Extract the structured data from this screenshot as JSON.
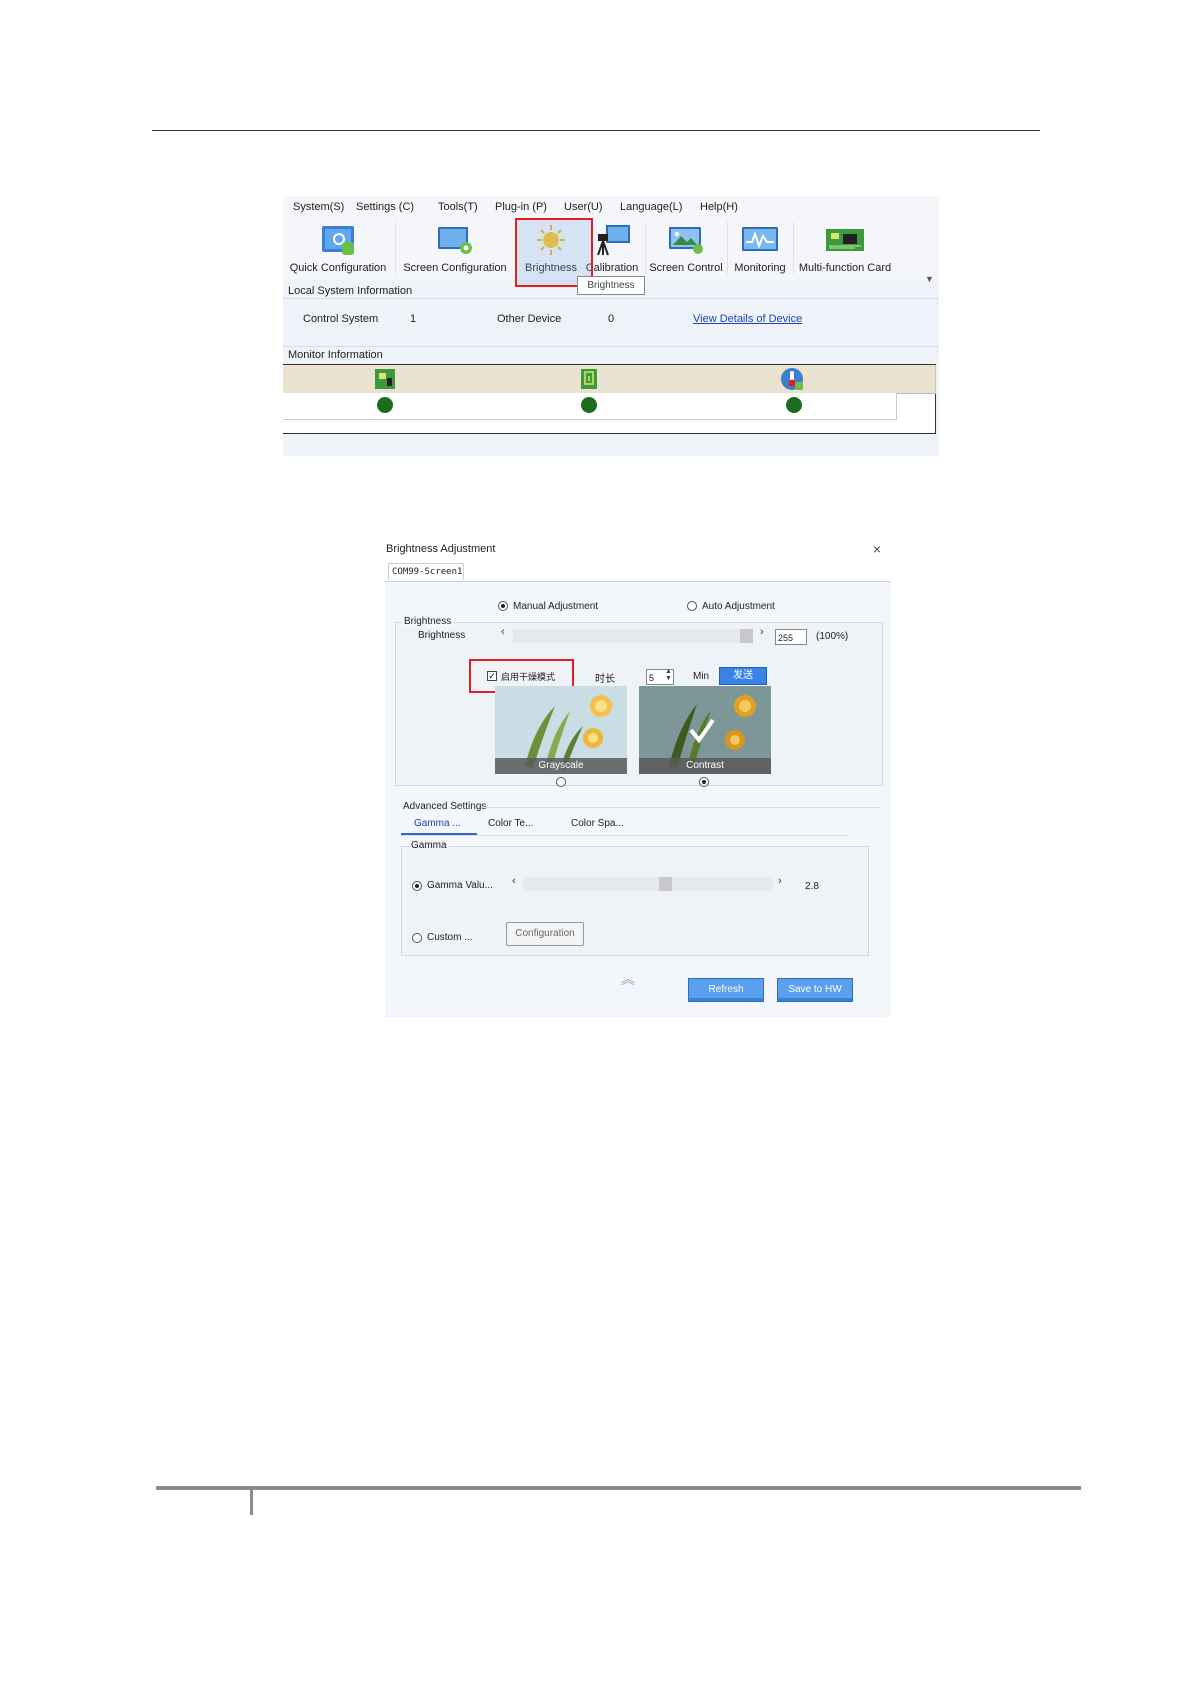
{
  "main_window": {
    "menu": [
      "System(S)",
      "Settings (C)",
      "Tools(T)",
      "Plug-in (P)",
      "User(U)",
      "Language(L)",
      "Help(H)"
    ],
    "toolbar": [
      "Quick Configuration",
      "Screen Configuration",
      "Brightness",
      "Calibration",
      "Screen Control",
      "Monitoring",
      "Multi-function Card"
    ],
    "tooltip": "Brightness",
    "local_info": {
      "heading": "Local System Information",
      "control_system_label": "Control System",
      "control_system_value": "1",
      "other_device_label": "Other Device",
      "other_device_value": "0",
      "details_link": "View Details of Device"
    },
    "monitor_heading": "Monitor Information",
    "monitor_icons": [
      "receiving-card-icon",
      "power-icon",
      "temperature-icon"
    ],
    "status_color": "#1d6b1d"
  },
  "dialog": {
    "title": "Brightness Adjustment",
    "screen_tab": "COM99-Screen1",
    "mode_manual": "Manual Adjustment",
    "mode_auto": "Auto Adjustment",
    "mode_selected": "Manual Adjustment",
    "brightness_group": "Brightness",
    "brightness_label": "Brightness",
    "brightness_value": "255",
    "brightness_percent": "(100%)",
    "brightness_fraction": 1.0,
    "dry_mode_label": "启用干燥模式",
    "dry_mode_checked": true,
    "duration_label": "时长",
    "duration_value": "5",
    "duration_unit": "Min",
    "send_label": "发送",
    "cards": [
      "Grayscale",
      "Contrast"
    ],
    "card_selected": "Contrast",
    "advanced_heading": "Advanced Settings",
    "advanced_tabs": [
      "Gamma ...",
      "Color Te...",
      "Color Spa..."
    ],
    "gamma_group": "Gamma",
    "gamma_value_label": "Gamma Valu...",
    "gamma_value": "2.8",
    "custom_label": "Custom ...",
    "configuration_label": "Configuration",
    "refresh_label": "Refresh",
    "save_label": "Save to HW",
    "accent_color": "#3a83e6"
  }
}
